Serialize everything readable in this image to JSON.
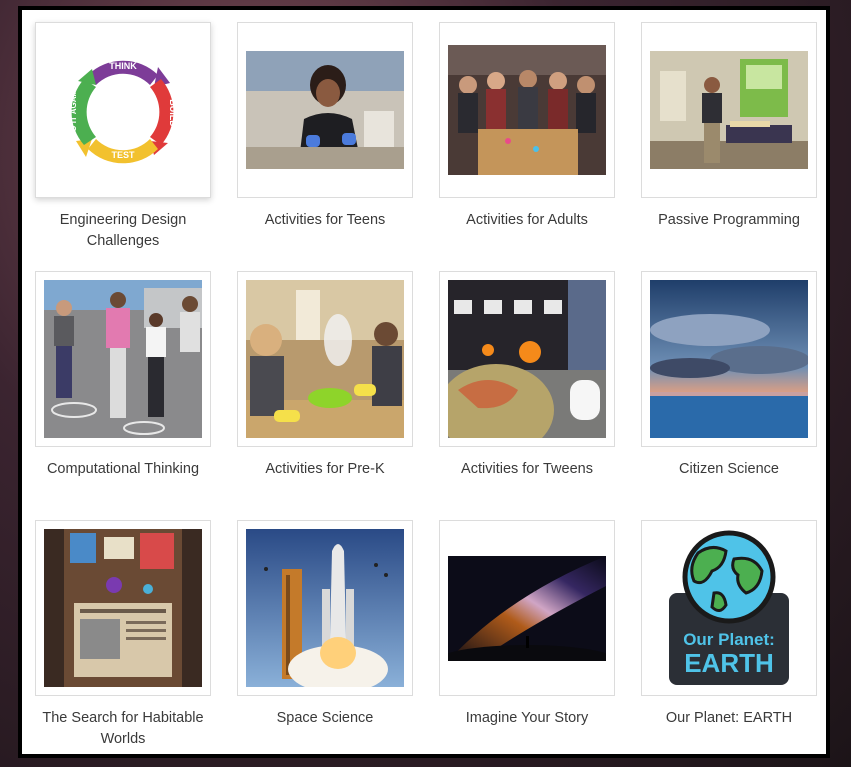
{
  "items": [
    {
      "label": "Engineering Design Challenges",
      "image": "engineering-cycle-icon"
    },
    {
      "label": "Activities for Teens",
      "image": "teen-lab-photo"
    },
    {
      "label": "Activities for Adults",
      "image": "adults-workshop-photo"
    },
    {
      "label": "Passive Programming",
      "image": "library-display-photo"
    },
    {
      "label": "Computational Thinking",
      "image": "kids-playground-photo"
    },
    {
      "label": "Activities for Pre-K",
      "image": "prek-experiment-photo"
    },
    {
      "label": "Activities for Tweens",
      "image": "tweens-event-photo"
    },
    {
      "label": "Citizen Science",
      "image": "ocean-sunset-photo"
    },
    {
      "label": "The Search for Habitable Worlds",
      "image": "habitable-worlds-book-photo"
    },
    {
      "label": "Space Science",
      "image": "shuttle-launch-photo"
    },
    {
      "label": "Imagine Your Story",
      "image": "milky-way-photo"
    },
    {
      "label": "Our Planet: EARTH",
      "image": "earth-logo"
    }
  ],
  "cycle": {
    "think": "THINK",
    "build": "BUILD",
    "test": "TEST",
    "do_again": "DO IT AGAIN"
  },
  "earth_logo": {
    "line1": "Our Planet:",
    "line2": "EARTH"
  },
  "colors": {
    "think": "#7d3c98",
    "build": "#e03a3a",
    "test": "#f2c12e",
    "again": "#4caf50",
    "earth_bg": "#2b2f36",
    "earth_text": "#4fc3e8"
  }
}
